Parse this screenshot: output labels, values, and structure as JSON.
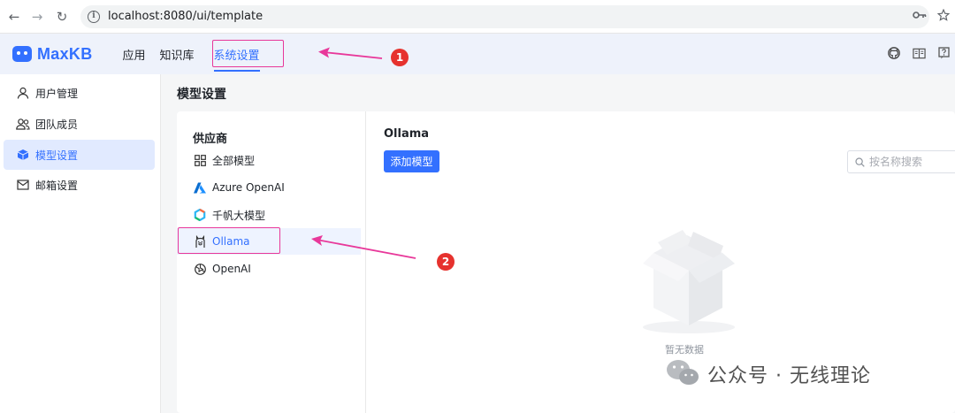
{
  "browser": {
    "url": "localhost:8080/ui/template"
  },
  "app": {
    "logo_text": "MaxKB",
    "brand_color": "#3370ff",
    "nav": [
      {
        "label": "应用"
      },
      {
        "label": "知识库"
      },
      {
        "label": "系统设置",
        "active": true
      }
    ]
  },
  "sidebar": {
    "items": [
      {
        "label": "用户管理",
        "icon": "user-icon"
      },
      {
        "label": "团队成员",
        "icon": "team-icon"
      },
      {
        "label": "模型设置",
        "icon": "cube-icon",
        "active": true
      },
      {
        "label": "邮箱设置",
        "icon": "mail-icon"
      }
    ]
  },
  "main": {
    "page_title": "模型设置",
    "providers_heading": "供应商",
    "providers": [
      {
        "label": "全部模型",
        "icon": "grid-icon"
      },
      {
        "label": "Azure OpenAI",
        "icon": "azure-icon"
      },
      {
        "label": "千帆大模型",
        "icon": "qianfan-icon"
      },
      {
        "label": "Ollama",
        "icon": "ollama-icon",
        "active": true
      },
      {
        "label": "OpenAI",
        "icon": "openai-icon"
      }
    ],
    "content_title": "Ollama",
    "add_button": "添加模型",
    "search_placeholder": "按名称搜索",
    "empty_text": "暂无数据"
  },
  "annotations": {
    "badge_1": "1",
    "badge_2": "2",
    "highlight_color": "#e8389a"
  },
  "watermark": {
    "text": "公众号 · 无线理论"
  }
}
